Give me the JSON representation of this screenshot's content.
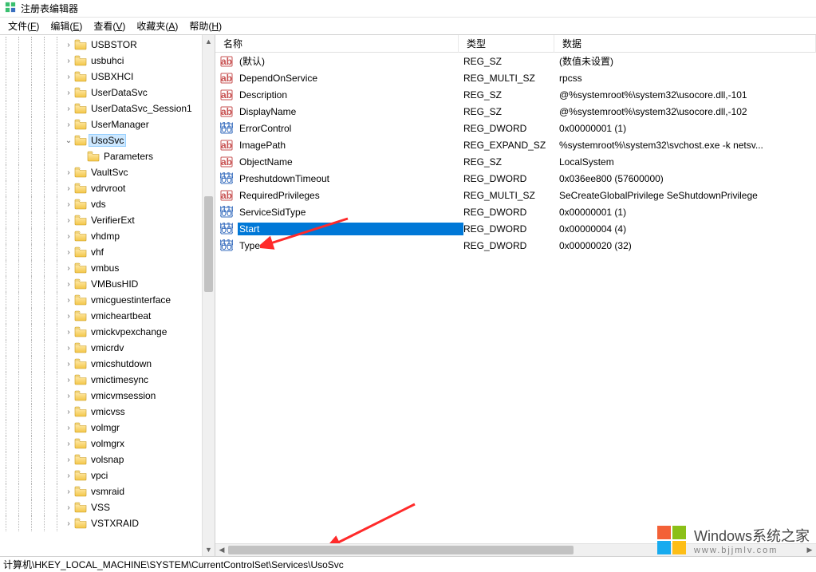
{
  "window": {
    "title": "注册表编辑器"
  },
  "menu": [
    {
      "label_pre": "文件(",
      "accel": "F",
      "label_post": ")"
    },
    {
      "label_pre": "编辑(",
      "accel": "E",
      "label_post": ")"
    },
    {
      "label_pre": "查看(",
      "accel": "V",
      "label_post": ")"
    },
    {
      "label_pre": "收藏夹(",
      "accel": "A",
      "label_post": ")"
    },
    {
      "label_pre": "帮助(",
      "accel": "H",
      "label_post": ")"
    }
  ],
  "tree": {
    "items": [
      {
        "indent": 5,
        "expander": "›",
        "label": "USBSTOR"
      },
      {
        "indent": 5,
        "expander": "›",
        "label": "usbuhci"
      },
      {
        "indent": 5,
        "expander": "›",
        "label": "USBXHCI"
      },
      {
        "indent": 5,
        "expander": "›",
        "label": "UserDataSvc"
      },
      {
        "indent": 5,
        "expander": "›",
        "label": "UserDataSvc_Session1"
      },
      {
        "indent": 5,
        "expander": "›",
        "label": "UserManager"
      },
      {
        "indent": 5,
        "expander": "⌄",
        "label": "UsoSvc",
        "selected": true
      },
      {
        "indent": 6,
        "expander": "",
        "label": "Parameters"
      },
      {
        "indent": 5,
        "expander": "›",
        "label": "VaultSvc"
      },
      {
        "indent": 5,
        "expander": "›",
        "label": "vdrvroot"
      },
      {
        "indent": 5,
        "expander": "›",
        "label": "vds"
      },
      {
        "indent": 5,
        "expander": "›",
        "label": "VerifierExt"
      },
      {
        "indent": 5,
        "expander": "›",
        "label": "vhdmp"
      },
      {
        "indent": 5,
        "expander": "›",
        "label": "vhf"
      },
      {
        "indent": 5,
        "expander": "›",
        "label": "vmbus"
      },
      {
        "indent": 5,
        "expander": "›",
        "label": "VMBusHID"
      },
      {
        "indent": 5,
        "expander": "›",
        "label": "vmicguestinterface"
      },
      {
        "indent": 5,
        "expander": "›",
        "label": "vmicheartbeat"
      },
      {
        "indent": 5,
        "expander": "›",
        "label": "vmickvpexchange"
      },
      {
        "indent": 5,
        "expander": "›",
        "label": "vmicrdv"
      },
      {
        "indent": 5,
        "expander": "›",
        "label": "vmicshutdown"
      },
      {
        "indent": 5,
        "expander": "›",
        "label": "vmictimesync"
      },
      {
        "indent": 5,
        "expander": "›",
        "label": "vmicvmsession"
      },
      {
        "indent": 5,
        "expander": "›",
        "label": "vmicvss"
      },
      {
        "indent": 5,
        "expander": "›",
        "label": "volmgr"
      },
      {
        "indent": 5,
        "expander": "›",
        "label": "volmgrx"
      },
      {
        "indent": 5,
        "expander": "›",
        "label": "volsnap"
      },
      {
        "indent": 5,
        "expander": "›",
        "label": "vpci"
      },
      {
        "indent": 5,
        "expander": "›",
        "label": "vsmraid"
      },
      {
        "indent": 5,
        "expander": "›",
        "label": "VSS"
      },
      {
        "indent": 5,
        "expander": "›",
        "label": "VSTXRAID"
      }
    ]
  },
  "columns": {
    "name": "名称",
    "type": "类型",
    "data": "数据"
  },
  "values": [
    {
      "icon": "str",
      "name": "(默认)",
      "type": "REG_SZ",
      "data": "(数值未设置)"
    },
    {
      "icon": "str",
      "name": "DependOnService",
      "type": "REG_MULTI_SZ",
      "data": "rpcss"
    },
    {
      "icon": "str",
      "name": "Description",
      "type": "REG_SZ",
      "data": "@%systemroot%\\system32\\usocore.dll,-101"
    },
    {
      "icon": "str",
      "name": "DisplayName",
      "type": "REG_SZ",
      "data": "@%systemroot%\\system32\\usocore.dll,-102"
    },
    {
      "icon": "bin",
      "name": "ErrorControl",
      "type": "REG_DWORD",
      "data": "0x00000001 (1)"
    },
    {
      "icon": "str",
      "name": "ImagePath",
      "type": "REG_EXPAND_SZ",
      "data": "%systemroot%\\system32\\svchost.exe -k netsv..."
    },
    {
      "icon": "str",
      "name": "ObjectName",
      "type": "REG_SZ",
      "data": "LocalSystem"
    },
    {
      "icon": "bin",
      "name": "PreshutdownTimeout",
      "type": "REG_DWORD",
      "data": "0x036ee800 (57600000)"
    },
    {
      "icon": "str",
      "name": "RequiredPrivileges",
      "type": "REG_MULTI_SZ",
      "data": "SeCreateGlobalPrivilege SeShutdownPrivilege"
    },
    {
      "icon": "bin",
      "name": "ServiceSidType",
      "type": "REG_DWORD",
      "data": "0x00000001 (1)"
    },
    {
      "icon": "bin",
      "name": "Start",
      "type": "REG_DWORD",
      "data": "0x00000004 (4)",
      "selected": true
    },
    {
      "icon": "bin",
      "name": "Type",
      "type": "REG_DWORD",
      "data": "0x00000020 (32)"
    }
  ],
  "statusbar": {
    "path": "计算机\\HKEY_LOCAL_MACHINE\\SYSTEM\\CurrentControlSet\\Services\\UsoSvc"
  },
  "watermark": {
    "line1": "Windows系统之家",
    "line2": "www.bjjmlv.com"
  },
  "arrows": {
    "color": "#ff2a2a"
  }
}
